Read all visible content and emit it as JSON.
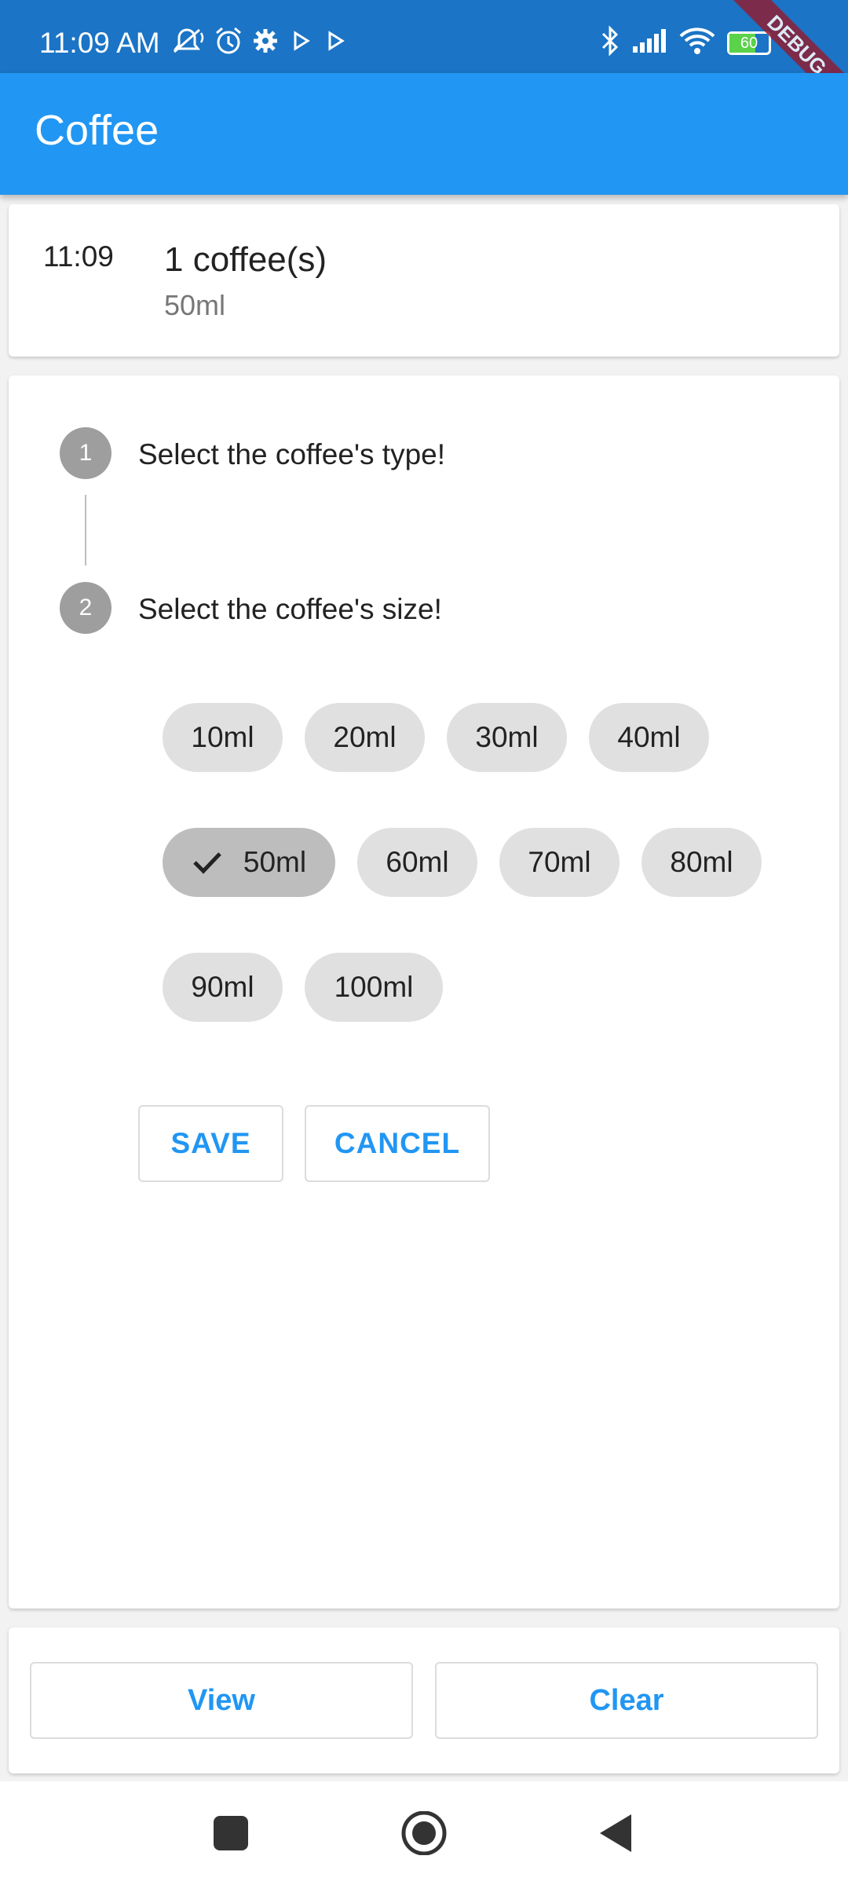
{
  "status_bar": {
    "time": "11:09 AM",
    "battery": "60",
    "debug_label": "DEBUG",
    "icons": [
      "mute-icon",
      "alarm-icon",
      "settings-icon",
      "play-icon",
      "play-icon",
      "bluetooth-icon",
      "signal-icon",
      "wifi-icon",
      "battery-icon"
    ]
  },
  "app_bar": {
    "title": "Coffee"
  },
  "history": {
    "time": "11:09",
    "count": "1 coffee(s)",
    "size": "50ml"
  },
  "stepper": {
    "steps": [
      {
        "number": "1",
        "title": "Select the coffee's type!"
      },
      {
        "number": "2",
        "title": "Select the coffee's size!"
      }
    ],
    "sizes": [
      "10ml",
      "20ml",
      "30ml",
      "40ml",
      "50ml",
      "60ml",
      "70ml",
      "80ml",
      "90ml",
      "100ml"
    ],
    "selected_size": "50ml",
    "save_label": "SAVE",
    "cancel_label": "CANCEL"
  },
  "bottom": {
    "view_label": "View",
    "clear_label": "Clear"
  },
  "colors": {
    "status_bar": "#1b74c5",
    "app_bar": "#2196f3",
    "accent": "#2196f3",
    "chip": "#e0e0e0",
    "chip_selected": "#bdbdbd"
  }
}
